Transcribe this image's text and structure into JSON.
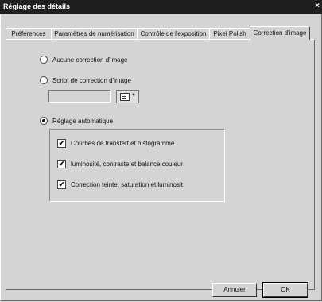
{
  "window": {
    "title": "Réglage des détails",
    "close": "×"
  },
  "tabs": [
    {
      "label": "Préférences"
    },
    {
      "label": "Paramètres de numérisation"
    },
    {
      "label": "Contrôle de l'exposition"
    },
    {
      "label": "Pixel Polish"
    },
    {
      "label": "Correction d'image"
    }
  ],
  "active_tab": "Correction d'image",
  "options": {
    "none_label": "Aucune correction d'image",
    "script_label": "Script de correction d'image",
    "script_value": "",
    "auto_label": "Réglage automatique",
    "selected": "auto"
  },
  "auto_options": [
    {
      "label": "Courbes de transfert et histogramme",
      "checked": true
    },
    {
      "label": "luminosité, contraste et balance couleur",
      "checked": true
    },
    {
      "label": "Correction teinte, saturation et luminosit",
      "checked": true
    }
  ],
  "buttons": {
    "cancel": "Annuler",
    "ok": "OK"
  }
}
